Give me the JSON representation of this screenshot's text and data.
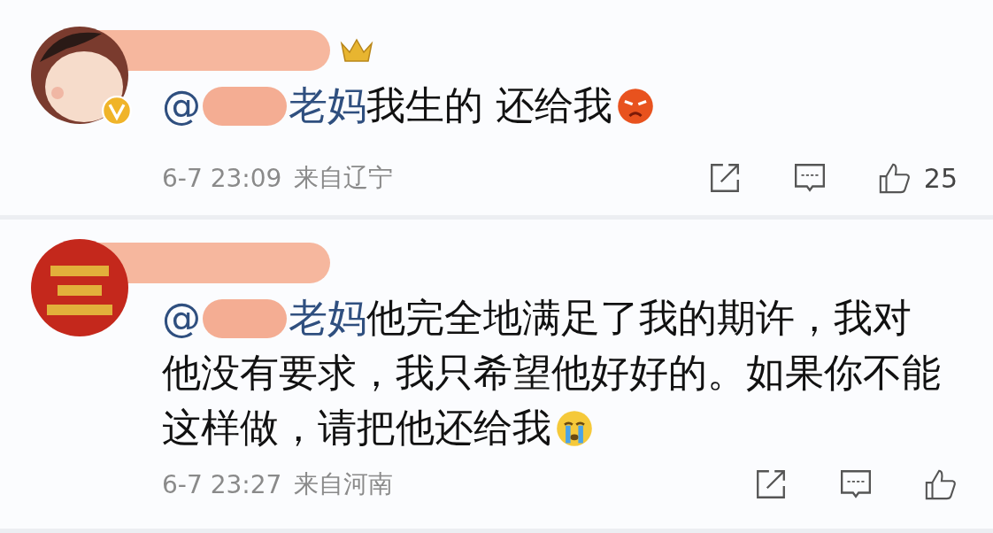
{
  "comments": [
    {
      "avatar": {
        "kind": "picture"
      },
      "verified": true,
      "crown": true,
      "mention": {
        "prefix": "@",
        "suffix": "老妈"
      },
      "lines": [
        "我生的 还给我"
      ],
      "time": "6-7 23:09",
      "location": "来自辽宁",
      "likes": "25"
    },
    {
      "avatar": {
        "kind": "picture"
      },
      "verified": false,
      "crown": false,
      "mention": {
        "prefix": "@",
        "suffix": "老妈"
      },
      "lines": [
        "他完全地满足了我的期许，我对",
        "他没有要求，我只希望他好好的。如果你不能",
        "这样做，请把他还给我"
      ],
      "time": "6-7 23:27",
      "location": "来自河南"
    }
  ]
}
